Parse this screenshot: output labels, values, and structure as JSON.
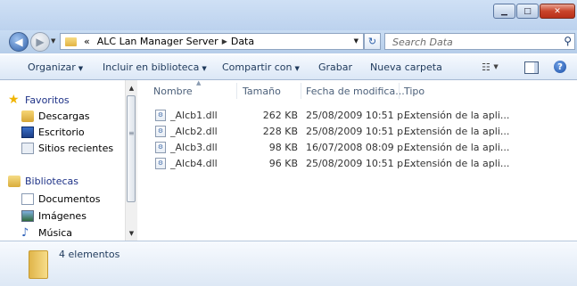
{
  "address": {
    "crumbs": [
      "«",
      "ALC Lan Manager Server",
      "Data"
    ],
    "search_placeholder": "Search Data"
  },
  "toolbar": {
    "organize": "Organizar",
    "include_library": "Incluir en biblioteca",
    "share_with": "Compartir con",
    "burn": "Grabar",
    "new_folder": "Nueva carpeta"
  },
  "nav": {
    "favorites": "Favoritos",
    "downloads": "Descargas",
    "desktop": "Escritorio",
    "recent": "Sitios recientes",
    "libraries": "Bibliotecas",
    "documents": "Documentos",
    "images": "Imágenes",
    "music": "Música"
  },
  "columns": {
    "name": "Nombre",
    "size": "Tamaño",
    "modified": "Fecha de modifica...",
    "type": "Tipo"
  },
  "files": [
    {
      "name": "_Alcb1.dll",
      "size": "262 KB",
      "modified": "25/08/2009 10:51 p....",
      "type": "Extensión de la apli..."
    },
    {
      "name": "_Alcb2.dll",
      "size": "228 KB",
      "modified": "25/08/2009 10:51 p....",
      "type": "Extensión de la apli..."
    },
    {
      "name": "_Alcb3.dll",
      "size": "98 KB",
      "modified": "16/07/2008 08:09 p....",
      "type": "Extensión de la apli..."
    },
    {
      "name": "_Alcb4.dll",
      "size": "96 KB",
      "modified": "25/08/2009 10:51 p....",
      "type": "Extensión de la apli..."
    }
  ],
  "status": {
    "item_count": "4 elementos"
  }
}
